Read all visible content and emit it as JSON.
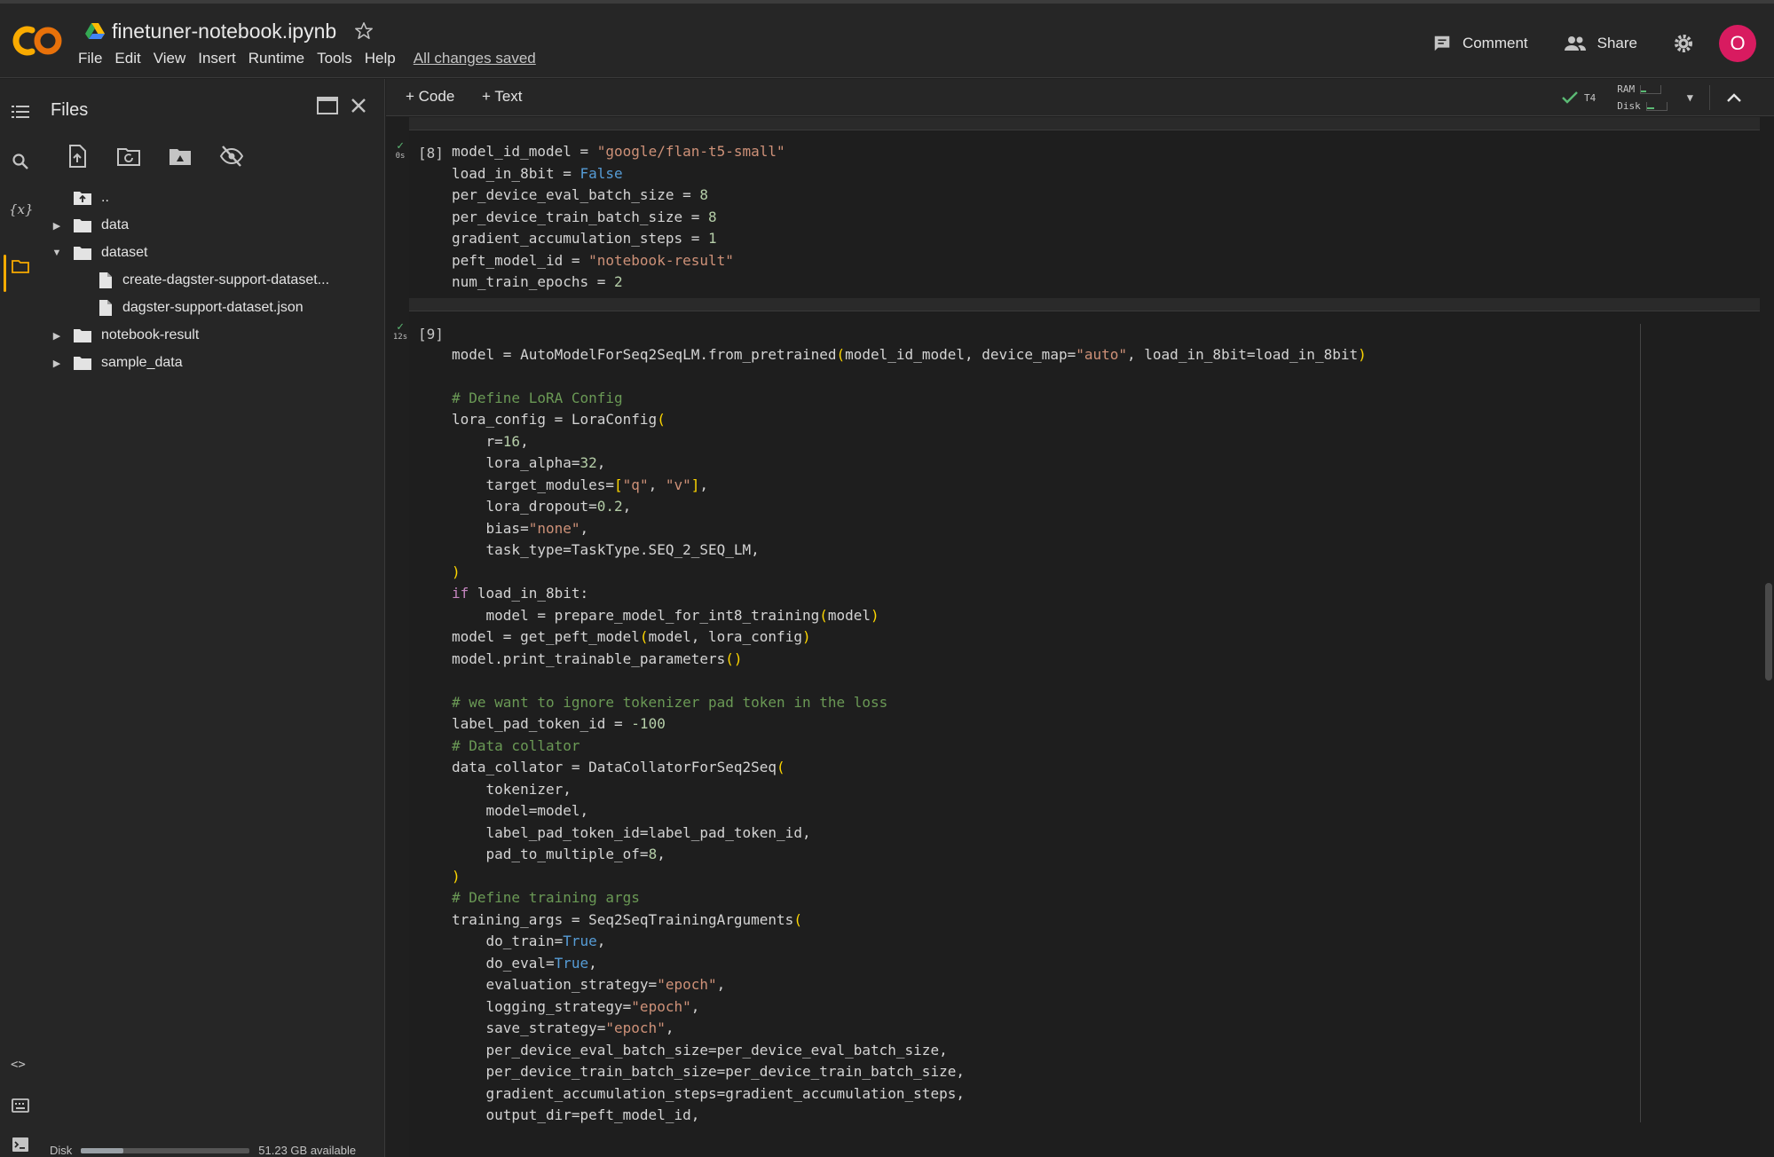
{
  "header": {
    "notebook_title": "finetuner-notebook.ipynb",
    "menu": [
      "File",
      "Edit",
      "View",
      "Insert",
      "Runtime",
      "Tools",
      "Help"
    ],
    "save_status": "All changes saved",
    "comment_label": "Comment",
    "share_label": "Share",
    "avatar_initial": "O",
    "avatar_color": "#d81b60"
  },
  "files_panel": {
    "title": "Files",
    "tree": [
      {
        "label": "..",
        "type": "folder-up",
        "depth": 0,
        "expanded": null
      },
      {
        "label": "data",
        "type": "folder",
        "depth": 0,
        "expanded": false
      },
      {
        "label": "dataset",
        "type": "folder",
        "depth": 0,
        "expanded": true
      },
      {
        "label": "create-dagster-support-dataset...",
        "type": "file",
        "depth": 1,
        "expanded": null
      },
      {
        "label": "dagster-support-dataset.json",
        "type": "file",
        "depth": 1,
        "expanded": null
      },
      {
        "label": "notebook-result",
        "type": "folder",
        "depth": 0,
        "expanded": false
      },
      {
        "label": "sample_data",
        "type": "folder",
        "depth": 0,
        "expanded": false
      }
    ],
    "disk_label": "Disk",
    "disk_available": "51.23 GB available",
    "disk_used_fraction": 0.25
  },
  "toolbar": {
    "add_code": "+ Code",
    "add_text": "+ Text",
    "runtime_type": "T4",
    "ram_label": "RAM",
    "disk_label": "Disk"
  },
  "cells": [
    {
      "exec_count": "[8]",
      "exec_time": "0s",
      "lines": [
        "model_id_model = \"google/flan-t5-small\"",
        "load_in_8bit = False",
        "per_device_eval_batch_size = 8",
        "per_device_train_batch_size = 8",
        "gradient_accumulation_steps = 1",
        "peft_model_id = \"notebook-result\"",
        "num_train_epochs = 2"
      ]
    },
    {
      "exec_count": "[9]",
      "exec_time": "12s",
      "lines": [
        "",
        "model = AutoModelForSeq2SeqLM.from_pretrained(model_id_model, device_map=\"auto\", load_in_8bit=load_in_8bit)",
        "",
        "# Define LoRA Config",
        "lora_config = LoraConfig(",
        "    r=16,",
        "    lora_alpha=32,",
        "    target_modules=[\"q\", \"v\"],",
        "    lora_dropout=0.2,",
        "    bias=\"none\",",
        "    task_type=TaskType.SEQ_2_SEQ_LM,",
        ")",
        "if load_in_8bit:",
        "    model = prepare_model_for_int8_training(model)",
        "model = get_peft_model(model, lora_config)",
        "model.print_trainable_parameters()",
        "",
        "# we want to ignore tokenizer pad token in the loss",
        "label_pad_token_id = -100",
        "# Data collator",
        "data_collator = DataCollatorForSeq2Seq(",
        "    tokenizer,",
        "    model=model,",
        "    label_pad_token_id=label_pad_token_id,",
        "    pad_to_multiple_of=8,",
        ")",
        "# Define training args",
        "training_args = Seq2SeqTrainingArguments(",
        "    do_train=True,",
        "    do_eval=True,",
        "    evaluation_strategy=\"epoch\",",
        "    logging_strategy=\"epoch\",",
        "    save_strategy=\"epoch\",",
        "    per_device_eval_batch_size=per_device_eval_batch_size,",
        "    per_device_train_batch_size=per_device_train_batch_size,",
        "    gradient_accumulation_steps=gradient_accumulation_steps,",
        "    output_dir=peft_model_id,"
      ]
    }
  ]
}
